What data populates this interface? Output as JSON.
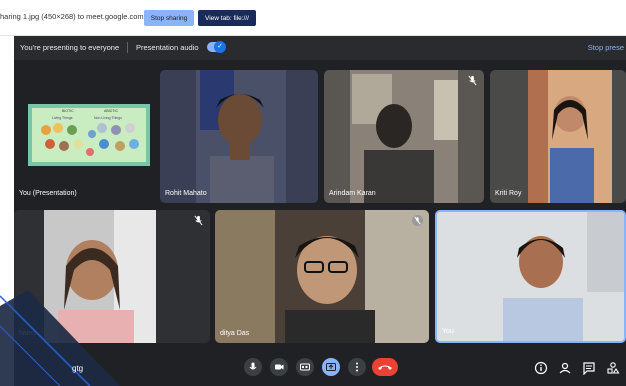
{
  "share_bar": {
    "text": "haring 1.jpg (450×268) to meet.google.com",
    "stop_label": "Stop sharing",
    "view_label": "View tab: file:///"
  },
  "present_bar": {
    "presenting_text": "You're presenting to everyone",
    "audio_label": "Presentation audio",
    "audio_on": true,
    "stop_label": "Stop prese"
  },
  "tiles": [
    {
      "name": "You (Presentation)",
      "muted": false
    },
    {
      "name": "Rohit Mahato",
      "muted": false
    },
    {
      "name": "Arindam Karan",
      "muted": true
    },
    {
      "name": "Kriti Roy",
      "muted": false
    },
    {
      "name": "harmi",
      "muted": true
    },
    {
      "name": "ditya Das",
      "muted": true
    },
    {
      "name": "You",
      "muted": false,
      "active": true
    }
  ],
  "slide": {
    "left_head": "BIOTIC",
    "right_head": "ABIOTIC",
    "left_sub": "Living Things",
    "right_sub": "Non Living Things"
  },
  "meeting_code": "gtg",
  "participants_badge": "7",
  "colors": {
    "meet_bg": "#202124",
    "tile_bg": "#3c4043",
    "accent": "#8ab4f8",
    "end_call": "#ea4335"
  }
}
